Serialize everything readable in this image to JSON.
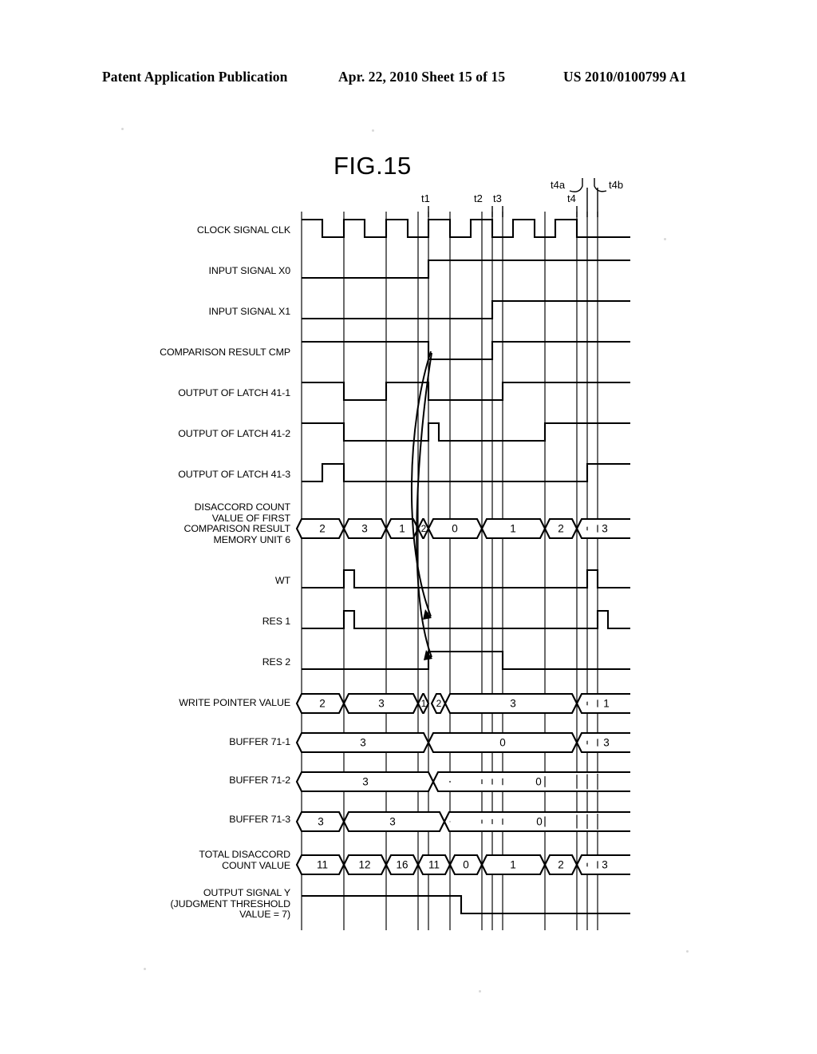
{
  "header": {
    "publication": "Patent Application Publication",
    "date_sheet": "Apr. 22, 2010  Sheet 15 of 15",
    "patent_number": "US 2010/0100799 A1"
  },
  "figure": {
    "title": "FIG.15"
  },
  "time_markers": [
    {
      "id": "t1",
      "label": "t1"
    },
    {
      "id": "t2",
      "label": "t2"
    },
    {
      "id": "t3",
      "label": "t3"
    },
    {
      "id": "t4",
      "label": "t4"
    },
    {
      "id": "t4a",
      "label": "t4a"
    },
    {
      "id": "t4b",
      "label": "t4b"
    }
  ],
  "rows": [
    {
      "id": "clk",
      "label": "CLOCK SIGNAL CLK"
    },
    {
      "id": "x0",
      "label": "INPUT SIGNAL X0"
    },
    {
      "id": "x1",
      "label": "INPUT SIGNAL X1"
    },
    {
      "id": "cmp",
      "label": "COMPARISON RESULT CMP"
    },
    {
      "id": "l1",
      "label": "OUTPUT OF LATCH 41-1"
    },
    {
      "id": "l2",
      "label": "OUTPUT OF LATCH 41-2"
    },
    {
      "id": "l3",
      "label": "OUTPUT OF LATCH 41-3"
    },
    {
      "id": "dis",
      "label": "DISACCORD COUNT\nVALUE OF FIRST\nCOMPARISON RESULT\nMEMORY UNIT 6"
    },
    {
      "id": "wt",
      "label": "WT"
    },
    {
      "id": "res1",
      "label": "RES 1"
    },
    {
      "id": "res2",
      "label": "RES 2"
    },
    {
      "id": "wp",
      "label": "WRITE POINTER VALUE"
    },
    {
      "id": "b1",
      "label": "BUFFER 71-1"
    },
    {
      "id": "b2",
      "label": "BUFFER 71-2"
    },
    {
      "id": "b3",
      "label": "BUFFER 71-3"
    },
    {
      "id": "total",
      "label": "TOTAL DISACCORD\nCOUNT VALUE"
    },
    {
      "id": "y",
      "label": "OUTPUT SIGNAL Y\n(JUDGMENT THRESHOLD\nVALUE = 7)"
    }
  ],
  "chart_data": {
    "type": "timing-diagram",
    "title": "FIG.15",
    "bus_values": {
      "disaccord_count_memory_unit_6": [
        "2",
        "3",
        "1",
        "2",
        "0",
        "1",
        "2",
        "3"
      ],
      "write_pointer_value": [
        "2",
        "3",
        "1",
        "2",
        "3",
        "1"
      ],
      "buffer_71_1": [
        "3",
        "0",
        "3"
      ],
      "buffer_71_2": [
        "3",
        "0"
      ],
      "buffer_71_3": [
        "3",
        "3",
        "0"
      ],
      "total_disaccord_count_value": [
        "11",
        "12",
        "16",
        "11",
        "0",
        "1",
        "2",
        "3"
      ]
    },
    "judgment_threshold_value": "7",
    "signals": {
      "clock_periods": 8,
      "input_signal_x0": "low then high from t1",
      "input_signal_x1": "low then high just before t3",
      "comparison_result_cmp": "high, low from t1, high from t3",
      "output_signal_y": "high then low from t3"
    },
    "annotations": [
      "curved arrow CMP to RES 1",
      "curved arrow CMP to RES 2"
    ]
  }
}
